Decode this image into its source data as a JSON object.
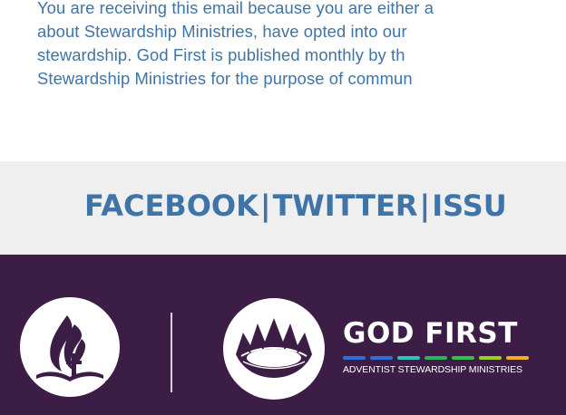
{
  "disclaimer": {
    "line1": "You are receiving this email because you are either a",
    "line2": "about Stewardship Ministries, have opted into our",
    "line3": "stewardship. God First is published monthly by th",
    "line4": "Stewardship Ministries for the purpose of commun"
  },
  "social_links": {
    "facebook": "FACEBOOK",
    "twitter": "TWITTER",
    "issuu": "ISSU",
    "separator": "|"
  },
  "footer": {
    "brand_title": "GOD FIRST",
    "brand_subtitle": "ADVENTIST STEWARDSHIP MINISTRIES",
    "registered_mark": "®",
    "bar_colors": [
      "#2f6fd8",
      "#2f6fd8",
      "#27c4c0",
      "#27b45a",
      "#2fc14a",
      "#9ad11f",
      "#f2b01e"
    ],
    "background_color": "#3b1d45"
  }
}
